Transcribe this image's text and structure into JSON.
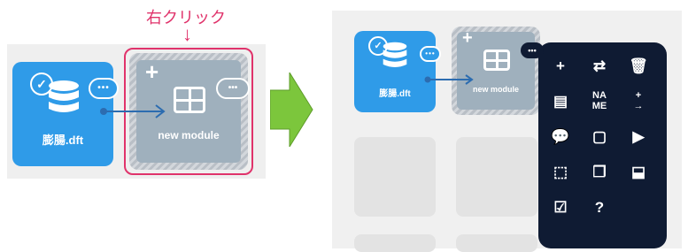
{
  "annotation": {
    "text": "右クリック",
    "color": "#e0336b",
    "arrow": "↓"
  },
  "left": {
    "source_node": {
      "label": "膨腸.dft",
      "more": "•••"
    },
    "module_node": {
      "label": "new module",
      "plus": "+",
      "more": "•••"
    }
  },
  "right": {
    "source_node": {
      "label": "膨腸.dft"
    },
    "module_node": {
      "label": "new module",
      "plus": "+"
    },
    "more_button": "•••",
    "menu_items": [
      {
        "icon": "add-box-icon",
        "glyph": "+"
      },
      {
        "icon": "swap-icon",
        "glyph": "⇄"
      },
      {
        "icon": "trash-icon",
        "glyph": "🗑"
      },
      {
        "icon": "id-card-icon",
        "glyph": "▤"
      },
      {
        "icon": "rename-icon",
        "glyph": "NA\nME"
      },
      {
        "icon": "add-arrow-icon",
        "glyph": "+\n→"
      },
      {
        "icon": "comment-icon",
        "glyph": "💬"
      },
      {
        "icon": "frame-icon",
        "glyph": "▢"
      },
      {
        "icon": "play-icon",
        "glyph": "▶"
      },
      {
        "icon": "select-remove-icon",
        "glyph": "⬚"
      },
      {
        "icon": "copy-stack-icon",
        "glyph": "❐"
      },
      {
        "icon": "inbox-icon",
        "glyph": "⬓"
      },
      {
        "icon": "checklist-icon",
        "glyph": "☑"
      },
      {
        "icon": "help-icon",
        "glyph": "?"
      }
    ]
  },
  "colors": {
    "node_blue": "#2f9be8",
    "menu_bg": "#0f1b33",
    "highlight": "#e0336b",
    "arrow_green": "#7cc63c"
  }
}
